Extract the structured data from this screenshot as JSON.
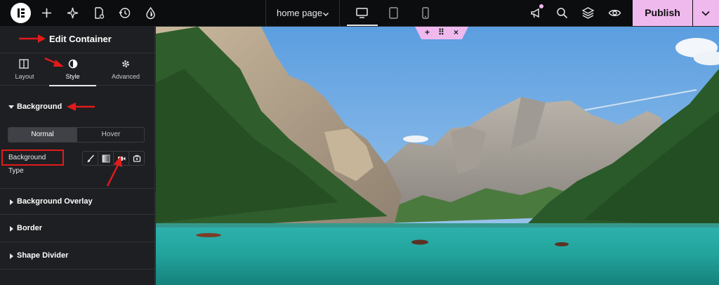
{
  "topbar": {
    "page_name": "home page",
    "publish_label": "Publish",
    "icons": [
      "elementor-logo",
      "add-icon",
      "sparkle-icon",
      "page-settings-icon",
      "history-icon",
      "theme-style-icon",
      "device-desktop-icon",
      "device-tablet-icon",
      "device-mobile-icon",
      "announcement-icon",
      "search-icon",
      "structure-icon",
      "preview-icon",
      "chevron-down-icon"
    ]
  },
  "panel": {
    "title": "Edit Container",
    "tabs": [
      {
        "label": "Layout",
        "icon": "layout-icon",
        "active": false
      },
      {
        "label": "Style",
        "icon": "style-icon",
        "active": true
      },
      {
        "label": "Advanced",
        "icon": "gear-icon",
        "active": false
      }
    ],
    "background_section": {
      "title": "Background",
      "state_tabs": [
        "Normal",
        "Hover"
      ],
      "active_state": "Normal",
      "type_label": "Background Type",
      "type_options": [
        "classic-brush-icon",
        "gradient-icon",
        "video-icon",
        "slideshow-icon"
      ]
    },
    "collapsed_sections": [
      "Background Overlay",
      "Border",
      "Shape Divider"
    ]
  },
  "canvas": {
    "handle_icons": [
      "+",
      "⠿",
      "×"
    ]
  },
  "colors": {
    "accent": "#f0b9ee",
    "highlight_red": "#e21b1b",
    "panel_bg": "#1e1f22",
    "topbar_bg": "#0c0d0e"
  }
}
